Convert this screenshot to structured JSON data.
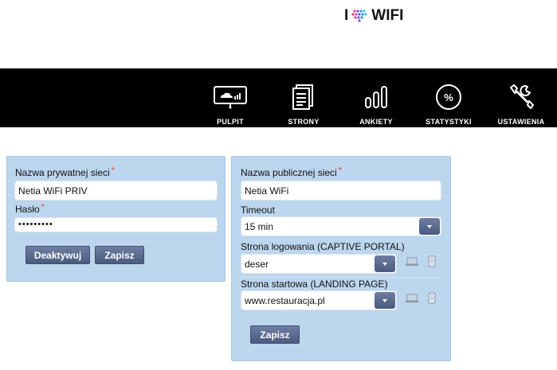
{
  "header": {
    "logo_letter": "I",
    "logo_text": "WIFI"
  },
  "nav": {
    "items": [
      {
        "label": "PULPIT",
        "icon": "dashboard-icon"
      },
      {
        "label": "STRONY",
        "icon": "pages-icon"
      },
      {
        "label": "ANKIETY",
        "icon": "survey-chart-icon"
      },
      {
        "label": "STATYSTYKI",
        "icon": "percent-icon"
      },
      {
        "label": "USTAWIENIA",
        "icon": "wrench-icon"
      }
    ]
  },
  "private_network": {
    "name_label": "Nazwa prywatnej sieci",
    "name_value": "Netia WiFi PRIV",
    "password_label": "Hasło",
    "password_value": "•••••••••",
    "required_mark": "*",
    "deactivate_label": "Deaktywuj",
    "save_label": "Zapisz"
  },
  "public_network": {
    "name_label": "Nazwa publicznej sieci",
    "name_value": "Netia WiFi",
    "required_mark": "*",
    "timeout_label": "Timeout",
    "timeout_value": "15 min",
    "captive_label": "Strona logowania (CAPTIVE PORTAL)",
    "captive_value": "deser",
    "landing_label": "Strona startowa (LANDING PAGE)",
    "landing_value": "www.restauracja.pl",
    "save_label": "Zapisz"
  },
  "colors": {
    "panel_bg": "#bcd6ee",
    "nav_bg": "#000000",
    "button_bg": "#56668b",
    "required": "#e03030"
  }
}
